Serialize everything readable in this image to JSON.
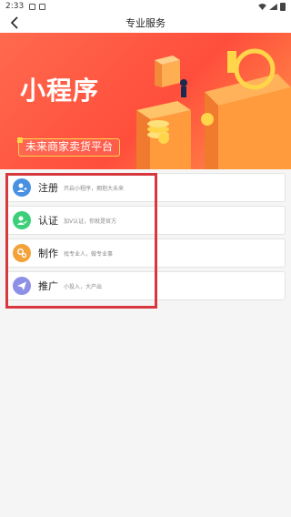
{
  "status": {
    "time": "2:33"
  },
  "nav": {
    "title": "专业服务"
  },
  "banner": {
    "headline": "小程序",
    "tagline": "未来商家卖货平台"
  },
  "menu": {
    "items": [
      {
        "label": "注册",
        "desc": "开启小程序，拥抱大未来",
        "color": "#4a90e2",
        "icon": "user-add-icon"
      },
      {
        "label": "认证",
        "desc": "加V认证，你就是官方",
        "color": "#3ccf7a",
        "icon": "user-verified-icon"
      },
      {
        "label": "制作",
        "desc": "找专业人，做专业事",
        "color": "#f3a23a",
        "icon": "gears-icon"
      },
      {
        "label": "推广",
        "desc": "小投入，大产出",
        "color": "#8e8fe6",
        "icon": "paper-plane-icon"
      }
    ]
  }
}
